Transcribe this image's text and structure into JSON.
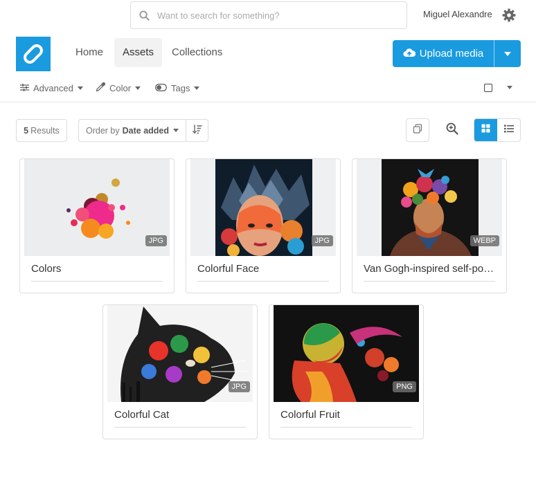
{
  "search": {
    "placeholder": "Want to search for something?"
  },
  "user": {
    "name": "Miguel Alexandre"
  },
  "nav": {
    "home": "Home",
    "assets": "Assets",
    "collections": "Collections"
  },
  "upload": {
    "label": "Upload media"
  },
  "filters": {
    "advanced": "Advanced",
    "color": "Color",
    "tags": "Tags"
  },
  "toolbar": {
    "results_count": "5",
    "results_label": "Results",
    "order_prefix": "Order by",
    "order_value": "Date added"
  },
  "accent_color": "#1a9be0",
  "assets": [
    {
      "title": "Colors",
      "format": "JPG"
    },
    {
      "title": "Colorful Face",
      "format": "JPG"
    },
    {
      "title": "Van Gogh-inspired self-portrait",
      "format": "WEBP"
    },
    {
      "title": "Colorful Cat",
      "format": "JPG"
    },
    {
      "title": "Colorful Fruit",
      "format": "PNG"
    }
  ]
}
